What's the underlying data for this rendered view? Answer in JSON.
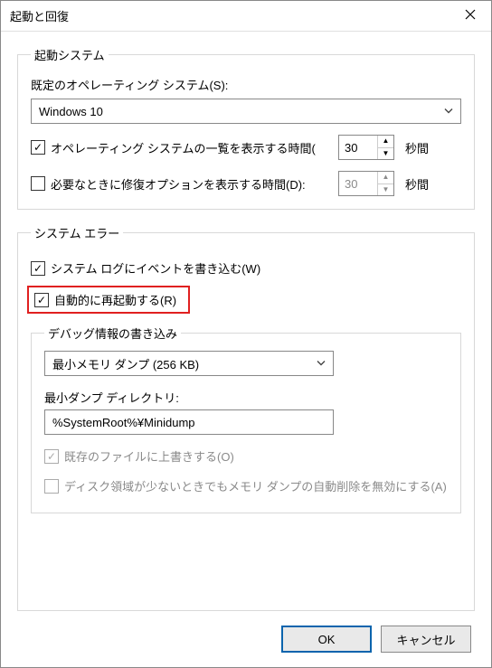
{
  "title": "起動と回復",
  "startup": {
    "legend": "起動システム",
    "os_label": "既定のオペレーティング システム(S):",
    "os_selected": "Windows 10",
    "show_os_list": {
      "checked": true,
      "label": "オペレーティング システムの一覧を表示する時間(",
      "value": "30",
      "unit": "秒間"
    },
    "show_recovery": {
      "checked": false,
      "label": "必要なときに修復オプションを表示する時間(D):",
      "value": "30",
      "unit": "秒間"
    }
  },
  "system_error": {
    "legend": "システム エラー",
    "write_event": {
      "checked": true,
      "label": "システム ログにイベントを書き込む(W)"
    },
    "auto_restart": {
      "checked": true,
      "label": "自動的に再起動する(R)"
    },
    "debug_legend": "デバッグ情報の書き込み",
    "dump_type": "最小メモリ ダンプ (256 KB)",
    "dir_label": "最小ダンプ ディレクトリ:",
    "dir_value": "%SystemRoot%¥Minidump",
    "overwrite": {
      "checked": true,
      "label": "既存のファイルに上書きする(O)"
    },
    "disable_delete": {
      "checked": false,
      "label": "ディスク領域が少ないときでもメモリ ダンプの自動削除を無効にする(A)"
    }
  },
  "buttons": {
    "ok": "OK",
    "cancel": "キャンセル"
  }
}
